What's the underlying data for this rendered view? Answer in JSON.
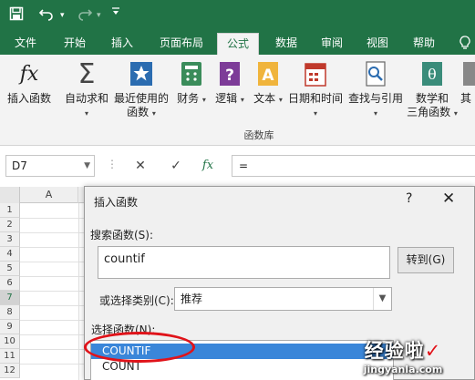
{
  "quick_access": {
    "save_icon": "save-icon",
    "undo_icon": "undo-icon",
    "redo_icon": "redo-icon",
    "customize_icon": "chevron-down-icon"
  },
  "tabs": [
    {
      "label": "文件",
      "active": false
    },
    {
      "label": "开始",
      "active": false
    },
    {
      "label": "插入",
      "active": false
    },
    {
      "label": "页面布局",
      "active": false
    },
    {
      "label": "公式",
      "active": true
    },
    {
      "label": "数据",
      "active": false
    },
    {
      "label": "审阅",
      "active": false
    },
    {
      "label": "视图",
      "active": false
    },
    {
      "label": "帮助",
      "active": false
    }
  ],
  "tell_me_icon": "lightbulb-icon",
  "ribbon": {
    "buttons": [
      {
        "line1": "插入函数",
        "line2": "",
        "icon": "fx-icon"
      },
      {
        "line1": "自动求和",
        "line2": "",
        "icon": "sigma-icon"
      },
      {
        "line1": "最近使用的",
        "line2": "函数",
        "icon": "star-icon"
      },
      {
        "line1": "财务",
        "line2": "",
        "icon": "finance-icon"
      },
      {
        "line1": "逻辑",
        "line2": "",
        "icon": "logic-icon"
      },
      {
        "line1": "文本",
        "line2": "",
        "icon": "text-icon"
      },
      {
        "line1": "日期和时间",
        "line2": "",
        "icon": "calendar-icon"
      },
      {
        "line1": "查找与引用",
        "line2": "",
        "icon": "lookup-icon"
      },
      {
        "line1": "数学和",
        "line2": "三角函数",
        "icon": "math-icon"
      },
      {
        "line1": "其",
        "line2": "",
        "icon": "more-icon"
      }
    ],
    "group_label": "函数库"
  },
  "formula_bar": {
    "name_box": "D7",
    "cancel": "✕",
    "enter": "✓",
    "fx": "fx",
    "content": "="
  },
  "grid": {
    "columns": [
      "A",
      "B",
      "C",
      "D",
      "E",
      "F"
    ],
    "rows": [
      "1",
      "2",
      "3",
      "4",
      "5",
      "6",
      "7",
      "8",
      "9",
      "10",
      "11",
      "12"
    ],
    "selected_row": "7"
  },
  "dialog": {
    "title": "插入函数",
    "help": "?",
    "close": "✕",
    "search_label": "搜索函数(S):",
    "search_value": "countif",
    "goto_button": "转到(G)",
    "category_label": "或选择类别(C):",
    "category_value": "推荐",
    "function_label": "选择函数(N):",
    "functions": [
      "COUNTIF",
      "COUNT"
    ],
    "selected_function": "COUNTIF"
  },
  "watermark": {
    "logo_text": "经验啦",
    "check": "✓",
    "url": "jingyanla.com"
  },
  "colors": {
    "excel_green": "#217346",
    "selection_blue": "#3a86d9",
    "annotation_red": "#e0131a"
  }
}
